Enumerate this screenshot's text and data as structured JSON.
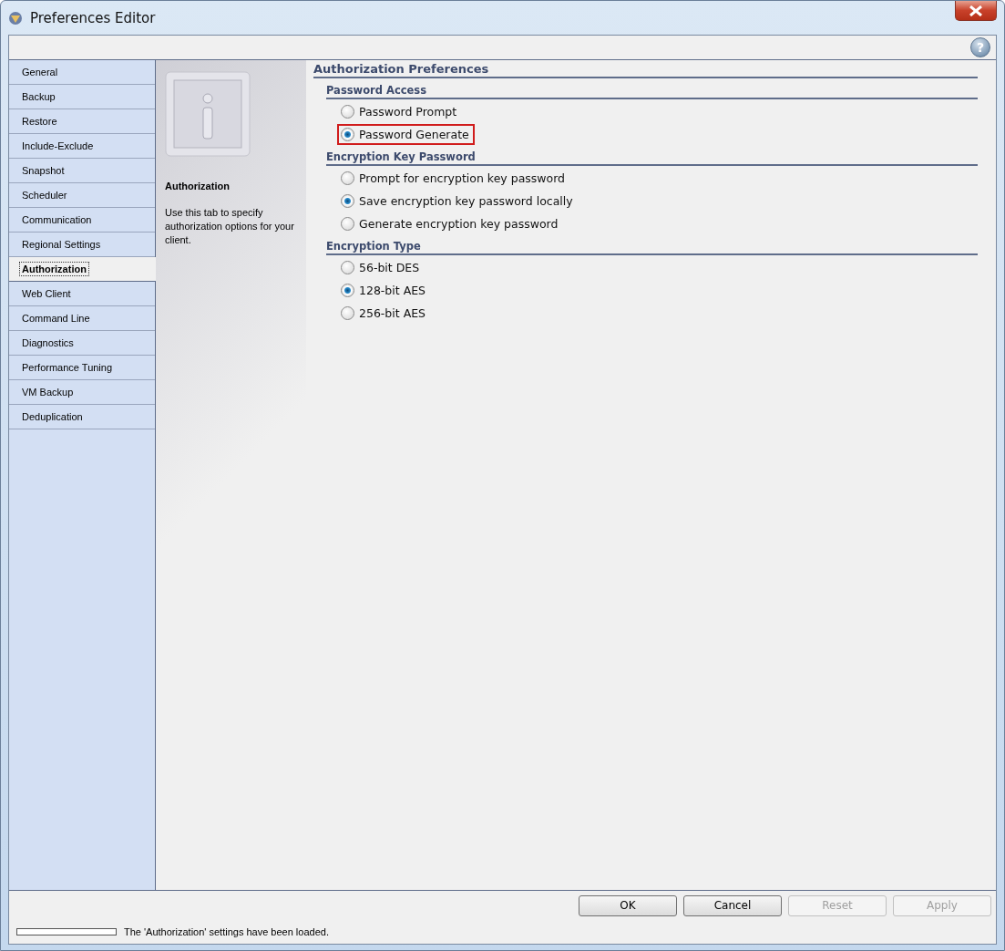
{
  "window": {
    "title": "Preferences Editor"
  },
  "help_button": "?",
  "tabs": [
    {
      "label": "General",
      "selected": false
    },
    {
      "label": "Backup",
      "selected": false
    },
    {
      "label": "Restore",
      "selected": false
    },
    {
      "label": "Include-Exclude",
      "selected": false
    },
    {
      "label": "Snapshot",
      "selected": false
    },
    {
      "label": "Scheduler",
      "selected": false
    },
    {
      "label": "Communication",
      "selected": false
    },
    {
      "label": "Regional Settings",
      "selected": false
    },
    {
      "label": "Authorization",
      "selected": true
    },
    {
      "label": "Web Client",
      "selected": false
    },
    {
      "label": "Command Line",
      "selected": false
    },
    {
      "label": "Diagnostics",
      "selected": false
    },
    {
      "label": "Performance Tuning",
      "selected": false
    },
    {
      "label": "VM Backup",
      "selected": false
    },
    {
      "label": "Deduplication",
      "selected": false
    }
  ],
  "info": {
    "title": "Authorization",
    "text": "Use this tab to specify authorization options for your client."
  },
  "panel": {
    "title": "Authorization Preferences",
    "groups": [
      {
        "title": "Password Access",
        "options": [
          {
            "label": "Password Prompt",
            "selected": false,
            "highlighted": false
          },
          {
            "label": "Password Generate",
            "selected": true,
            "highlighted": true
          }
        ]
      },
      {
        "title": "Encryption Key Password",
        "options": [
          {
            "label": "Prompt for encryption key password",
            "selected": false,
            "highlighted": false
          },
          {
            "label": "Save encryption key password locally",
            "selected": true,
            "highlighted": false
          },
          {
            "label": "Generate encryption key password",
            "selected": false,
            "highlighted": false
          }
        ]
      },
      {
        "title": "Encryption Type",
        "options": [
          {
            "label": "56-bit DES",
            "selected": false,
            "highlighted": false
          },
          {
            "label": "128-bit AES",
            "selected": true,
            "highlighted": false
          },
          {
            "label": "256-bit AES",
            "selected": false,
            "highlighted": false
          }
        ]
      }
    ]
  },
  "buttons": [
    {
      "label": "OK",
      "disabled": false
    },
    {
      "label": "Cancel",
      "disabled": false
    },
    {
      "label": "Reset",
      "disabled": true
    },
    {
      "label": "Apply",
      "disabled": true
    }
  ],
  "status_bar": {
    "level": 0,
    "text": "The 'Authorization' settings have been loaded."
  }
}
